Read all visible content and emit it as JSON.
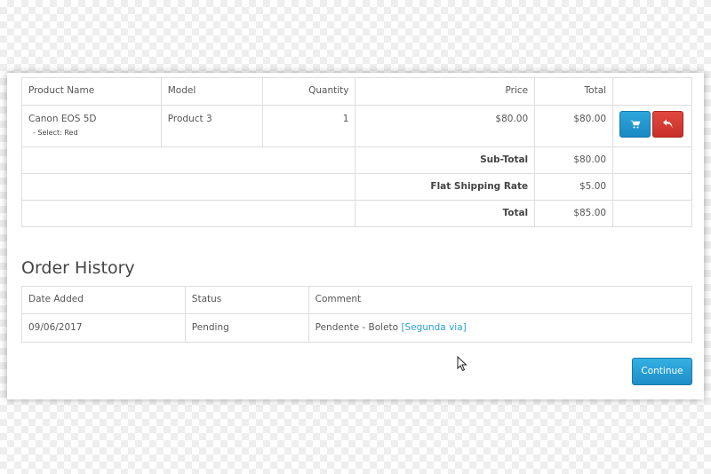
{
  "order_table": {
    "headers": {
      "product_name": "Product Name",
      "model": "Model",
      "quantity": "Quantity",
      "price": "Price",
      "total": "Total"
    },
    "items": [
      {
        "product_name": "Canon EOS 5D",
        "option": "- Select: Red",
        "model": "Product 3",
        "quantity": "1",
        "price": "$80.00",
        "total": "$80.00"
      }
    ],
    "totals": [
      {
        "label": "Sub-Total",
        "value": "$80.00"
      },
      {
        "label": "Flat Shipping Rate",
        "value": "$5.00"
      },
      {
        "label": "Total",
        "value": "$85.00"
      }
    ],
    "reorder_icon": "cart-icon",
    "return_icon": "reply-icon"
  },
  "order_history": {
    "title": "Order History",
    "headers": {
      "date_added": "Date Added",
      "status": "Status",
      "comment": "Comment"
    },
    "rows": [
      {
        "date_added": "09/06/2017",
        "status": "Pending",
        "comment": "Pendente - Boleto",
        "link": "[Segunda via]"
      }
    ]
  },
  "continue_label": "Continue",
  "colors": {
    "primary": "#1e91cc",
    "danger": "#d33a32",
    "link": "#2a9fd6"
  }
}
